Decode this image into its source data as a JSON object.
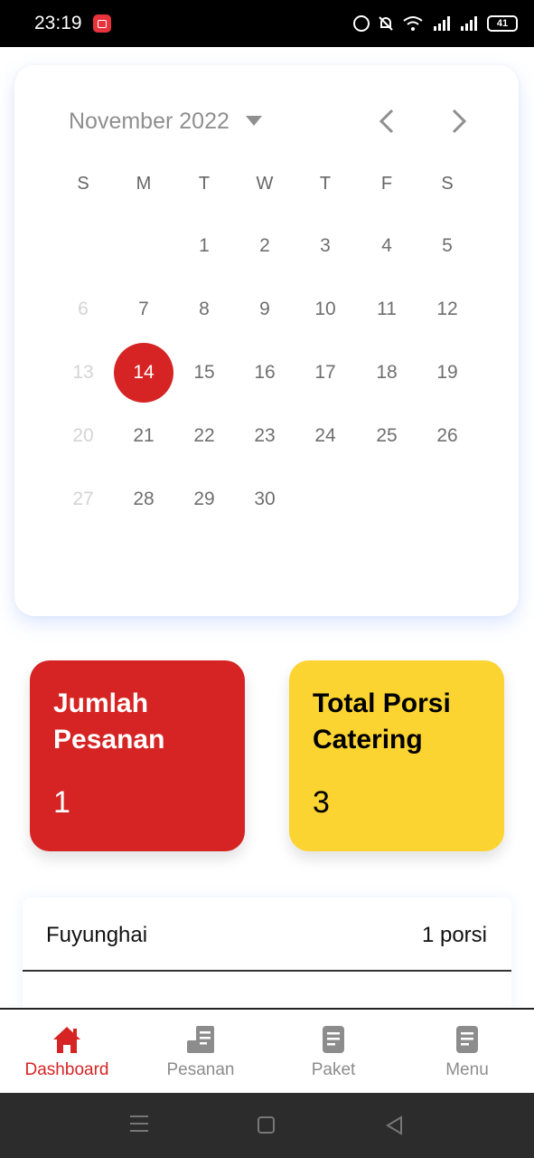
{
  "status_bar": {
    "time": "23:19",
    "battery": "41",
    "icons": [
      "screen-record-icon",
      "alarm-icon",
      "mute-icon",
      "wifi-icon",
      "signal-icon",
      "signal-icon",
      "battery-icon"
    ]
  },
  "calendar": {
    "month_label": "November 2022",
    "weekdays": [
      "S",
      "M",
      "T",
      "W",
      "T",
      "F",
      "S"
    ],
    "weeks": [
      [
        null,
        null,
        {
          "d": "1"
        },
        {
          "d": "2"
        },
        {
          "d": "3"
        },
        {
          "d": "4"
        },
        {
          "d": "5"
        }
      ],
      [
        {
          "d": "6",
          "muted": true
        },
        {
          "d": "7"
        },
        {
          "d": "8"
        },
        {
          "d": "9"
        },
        {
          "d": "10"
        },
        {
          "d": "11"
        },
        {
          "d": "12"
        }
      ],
      [
        {
          "d": "13",
          "muted": true
        },
        {
          "d": "14",
          "selected": true
        },
        {
          "d": "15"
        },
        {
          "d": "16"
        },
        {
          "d": "17"
        },
        {
          "d": "18"
        },
        {
          "d": "19"
        }
      ],
      [
        {
          "d": "20",
          "muted": true
        },
        {
          "d": "21"
        },
        {
          "d": "22"
        },
        {
          "d": "23"
        },
        {
          "d": "24"
        },
        {
          "d": "25"
        },
        {
          "d": "26"
        }
      ],
      [
        {
          "d": "27",
          "muted": true
        },
        {
          "d": "28"
        },
        {
          "d": "29"
        },
        {
          "d": "30"
        },
        null,
        null,
        null
      ]
    ],
    "selected_color": "#d62424"
  },
  "summary": {
    "orders": {
      "title": "Jumlah Pesanan",
      "value": "1",
      "color": "#d62424"
    },
    "portions": {
      "title": "Total Porsi Catering",
      "value": "3",
      "color": "#fcd431"
    }
  },
  "order_list": [
    {
      "name": "Fuyunghai",
      "qty": "1 porsi"
    }
  ],
  "bottom_nav": {
    "items": [
      {
        "label": "Dashboard",
        "icon": "home-icon",
        "active": true
      },
      {
        "label": "Pesanan",
        "icon": "receipt-icon",
        "active": false
      },
      {
        "label": "Paket",
        "icon": "document-icon",
        "active": false
      },
      {
        "label": "Menu",
        "icon": "document-icon",
        "active": false
      }
    ],
    "active_color": "#d62424",
    "inactive_color": "#8c8c8c"
  }
}
